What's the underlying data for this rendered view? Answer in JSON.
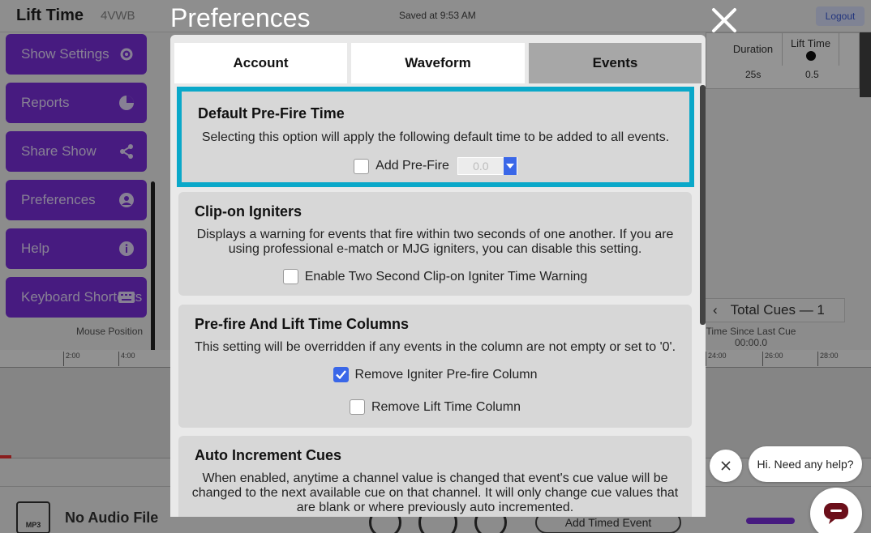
{
  "background": {
    "app_title": "Lift Time",
    "show_code": "4VWB",
    "saved_status": "Saved at 9:53 AM",
    "logout_label": "Logout",
    "sidebar": [
      {
        "label": "Show Settings",
        "icon": "gear-icon"
      },
      {
        "label": "Reports",
        "icon": "pie-chart-icon"
      },
      {
        "label": "Share Show",
        "icon": "share-icon"
      },
      {
        "label": "Preferences",
        "icon": "user-icon"
      },
      {
        "label": "Help",
        "icon": "info-icon"
      },
      {
        "label": "Keyboard Shortcuts",
        "icon": "keyboard-icon"
      }
    ],
    "table": {
      "col_duration": "Duration",
      "col_lift_time": "Lift Time",
      "duration_value": "25s",
      "lift_time_value": "0.5"
    },
    "total_cues": "Total Cues — 1",
    "time_since_last_cue_label": "Time Since Last Cue",
    "time_since_last_cue_value": "00:00.0",
    "mouse_position_label": "Mouse Position",
    "ruler_ticks": [
      "2:00",
      "4:00",
      "24:00",
      "26:00",
      "28:00"
    ],
    "no_audio": "No Audio File",
    "add_timed_event": "Add Timed Event",
    "mp3_label": "MP3",
    "accent_color": "#7a2fdc"
  },
  "modal": {
    "title": "Preferences",
    "tabs": [
      {
        "label": "Account",
        "active": false
      },
      {
        "label": "Waveform",
        "active": false
      },
      {
        "label": "Events",
        "active": true
      }
    ],
    "sections": {
      "pre_fire": {
        "title": "Default Pre-Fire Time",
        "description": "Selecting this option will apply the following default time to be added to all events.",
        "option_label": "Add Pre-Fire",
        "checked": false,
        "value": "0.0"
      },
      "clip_on": {
        "title": "Clip-on Igniters",
        "description": "Displays a warning for events that fire within two seconds of one another. If you are using professional e-match or MJG igniters, you can disable this setting.",
        "option_label": "Enable Two Second Clip-on Igniter Time Warning",
        "checked": false
      },
      "columns": {
        "title": "Pre-fire And Lift Time Columns",
        "description": "This setting will be overridden if any events in the column are not empty or set to '0'.",
        "option1_label": "Remove Igniter Pre-fire Column",
        "option1_checked": true,
        "option2_label": "Remove Lift Time Column",
        "option2_checked": false
      },
      "auto_increment": {
        "title": "Auto Increment Cues",
        "description": "When enabled, anytime a channel value is changed that event's cue value will be changed to the next available cue on that channel. It will only change cue values that are blank or where previously auto incremented."
      }
    },
    "highlight_color": "#0aa8c9",
    "checkbox_color": "#3a67e8"
  },
  "chat": {
    "greeting": "Hi. Need any help?"
  }
}
